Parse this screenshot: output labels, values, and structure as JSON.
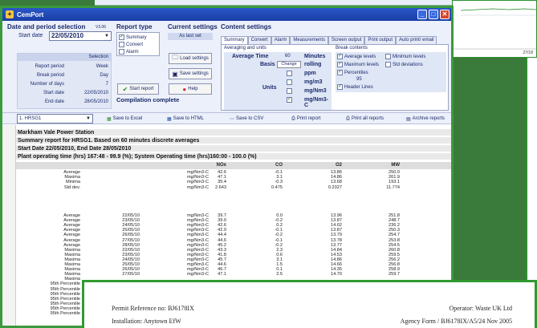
{
  "window": {
    "title": "CemPort"
  },
  "date_period": {
    "title": "Date and period selection",
    "version": "V3.06",
    "start_date_label": "Start date",
    "start_date_value": "22/05/2010",
    "selection_header": "Selection",
    "rows": [
      {
        "label": "Report period",
        "value": "Week"
      },
      {
        "label": "Break period",
        "value": "Day"
      },
      {
        "label": "Number of days",
        "value": "7"
      },
      {
        "label": "Start date",
        "value": "22/05/2010"
      },
      {
        "label": "End date",
        "value": "28/05/2010"
      }
    ]
  },
  "report_type": {
    "title": "Report type",
    "options": [
      {
        "label": "Summary",
        "checked": true
      },
      {
        "label": "Convert",
        "checked": false
      },
      {
        "label": "Alarm",
        "checked": false
      }
    ],
    "start_button": "Start report",
    "status": "Compilation complete"
  },
  "current_settings": {
    "title": "Current settings",
    "as_last": "As last set",
    "load": "Load settings",
    "save": "Save settings",
    "help": "Help"
  },
  "content_settings": {
    "title": "Content settings",
    "tabs": [
      "Summary",
      "Convert",
      "Alarm",
      "Measurements",
      "Screen output",
      "Print output",
      "Auto print/ email"
    ],
    "averaging_title": "Averaging and units",
    "average_time_label": "Average Time",
    "average_time_value": "60",
    "average_time_unit": "Minutes",
    "basis_label": "Basis",
    "basis_button": "Change",
    "basis_value": "rolling",
    "units_label": "Units",
    "units": [
      {
        "label": "ppm",
        "checked": false
      },
      {
        "label": "mg/m3",
        "checked": false
      },
      {
        "label": "mg/Nm3",
        "checked": false
      },
      {
        "label": "mg/Nm3-C",
        "checked": true
      }
    ],
    "break_title": "Break contents",
    "break_items": [
      {
        "label": "Average levels",
        "checked": true
      },
      {
        "label": "Minimum levels",
        "checked": false
      },
      {
        "label": "Maximum levels",
        "checked": true
      },
      {
        "label": "Std deviations",
        "checked": false
      },
      {
        "label": "Percentiles",
        "checked": true
      },
      {
        "label": "Header Lines",
        "checked": true
      }
    ],
    "percentile_value": "95"
  },
  "toolbar": {
    "source": "1. HRSG1",
    "excel": "Save to Excel",
    "html": "Save to HTML",
    "csv": "Save to CSV",
    "print": "Print report",
    "print_all": "Print all reports",
    "archive": "Archive reports"
  },
  "report": {
    "line1": "Markham Vale Power Station",
    "line2": "Summary report for HRSG1.  Based on 60 minutes discrete averages",
    "line3": "Start Date 22/05/2010, End Date 28/05/2010",
    "line4": "Plant operating time (hrs) 167:48 - 99.9 (%); System Operating time (hrs)160:00 - 100.0 (%)",
    "columns": [
      "NOx",
      "CO",
      "O2",
      "MW"
    ],
    "summary_rows": [
      [
        "Average",
        "",
        "mg/Nm3-C",
        "42.6",
        "-0.1",
        "13.86",
        "250.0"
      ],
      [
        "Maxima",
        "",
        "mg/Nm3-C",
        "47.1",
        "3.1",
        "14.86",
        "261.9"
      ],
      [
        "Minima",
        "",
        "mg/Nm3-C",
        "35.4",
        "-0.3",
        "13.68",
        "193.1"
      ],
      [
        "Std dev.",
        "",
        "mg/Nm3-C",
        "2.643",
        "0.475",
        "0.2327",
        "11.774"
      ]
    ],
    "daily_rows": [
      [
        "Average",
        "22/05/10",
        "mg/Nm3-C",
        "39.7",
        "0.0",
        "13.96",
        "251.8"
      ],
      [
        "Average",
        "23/05/10",
        "mg/Nm3-C",
        "39.0",
        "-0.2",
        "13.87",
        "248.7"
      ],
      [
        "Average",
        "24/05/10",
        "mg/Nm3-C",
        "42.6",
        "0.2",
        "14.02",
        "236.2"
      ],
      [
        "Average",
        "25/05/10",
        "mg/Nm3-C",
        "42.9",
        "-0.1",
        "13.87",
        "250.3"
      ],
      [
        "Average",
        "26/05/10",
        "mg/Nm3-C",
        "44.4",
        "-0.2",
        "13.79",
        "254.7"
      ],
      [
        "Average",
        "27/05/10",
        "mg/Nm3-C",
        "44.6",
        "-0.1",
        "13.78",
        "253.8"
      ],
      [
        "Average",
        "28/05/10",
        "mg/Nm3-C",
        "45.2",
        "-0.2",
        "13.77",
        "254.5"
      ],
      [
        "Maxima",
        "22/05/10",
        "mg/Nm3-C",
        "43.3",
        "2.3",
        "14.84",
        "260.8"
      ],
      [
        "Maxima",
        "23/05/10",
        "mg/Nm3-C",
        "41.8",
        "0.6",
        "14.53",
        "259.5"
      ],
      [
        "Maxima",
        "24/05/10",
        "mg/Nm3-C",
        "45.7",
        "3.1",
        "14.86",
        "256.2"
      ],
      [
        "Maxima",
        "25/05/10",
        "mg/Nm3-C",
        "44.6",
        "1.5",
        "14.66",
        "256.8"
      ],
      [
        "Maxima",
        "26/05/10",
        "mg/Nm3-C",
        "46.7",
        "0.1",
        "14.35",
        "258.9"
      ],
      [
        "Maxima",
        "27/05/10",
        "mg/Nm3-C",
        "47.1",
        "2.5",
        "14.70",
        "259.7"
      ],
      [
        "Maxima",
        "",
        "",
        "",
        "",
        "",
        ""
      ],
      [
        "95th Percentile",
        "",
        "",
        "",
        "",
        "",
        ""
      ],
      [
        "95th Percentile",
        "",
        "",
        "",
        "",
        "",
        ""
      ],
      [
        "95th Percentile",
        "",
        "",
        "",
        "",
        "",
        ""
      ],
      [
        "95th Percentile",
        "",
        "",
        "",
        "",
        "",
        ""
      ],
      [
        "95th Percentile",
        "",
        "",
        "",
        "",
        "",
        ""
      ],
      [
        "95th Percentile",
        "",
        "",
        "",
        "",
        "",
        ""
      ],
      [
        "95th Percentile",
        "",
        "",
        "",
        "",
        "",
        ""
      ]
    ]
  },
  "popup": {
    "permit": "Permit Reference no: BJ6178IX",
    "installation": "Installation: Anytown EfW",
    "operator": "Operator: Waste UK Ltd",
    "agency": "Agency Form / BJ6178IX/A5/24  Nov 2005"
  },
  "background": {
    "axis_tick": "27/18"
  }
}
